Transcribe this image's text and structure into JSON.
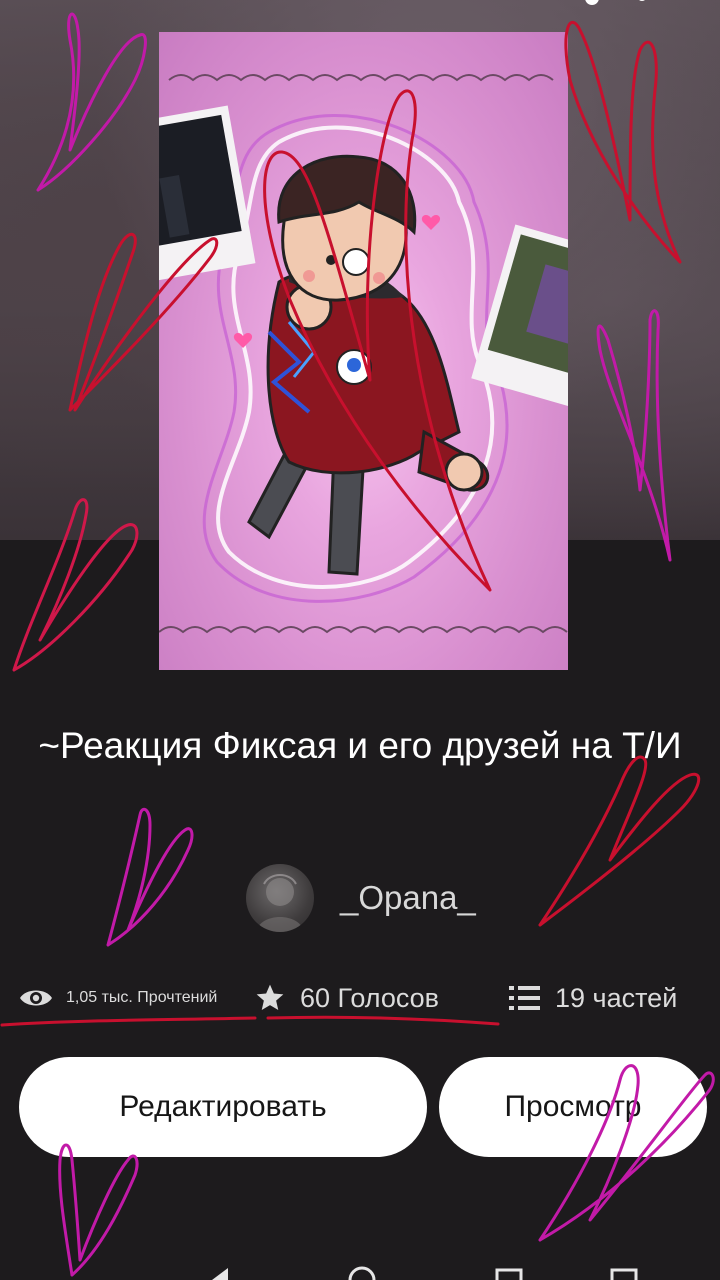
{
  "story": {
    "title": "~Реакция Фиксая и его друзей на Т/И",
    "author": "_Opana_"
  },
  "stats": {
    "reads": "1,05 тыс. Прочтений",
    "votes": "60 Голосов",
    "parts": "19 частей"
  },
  "buttons": {
    "edit": "Редактировать",
    "view": "Просмотр"
  },
  "icons": {
    "reads": "eye-icon",
    "votes": "star-icon",
    "parts": "list-icon"
  },
  "colors": {
    "background": "#1d1b1d",
    "button_bg": "#ffffff",
    "text_primary": "#ffffff",
    "heart_red": "#c8102e",
    "heart_magenta": "#c21aa8"
  }
}
